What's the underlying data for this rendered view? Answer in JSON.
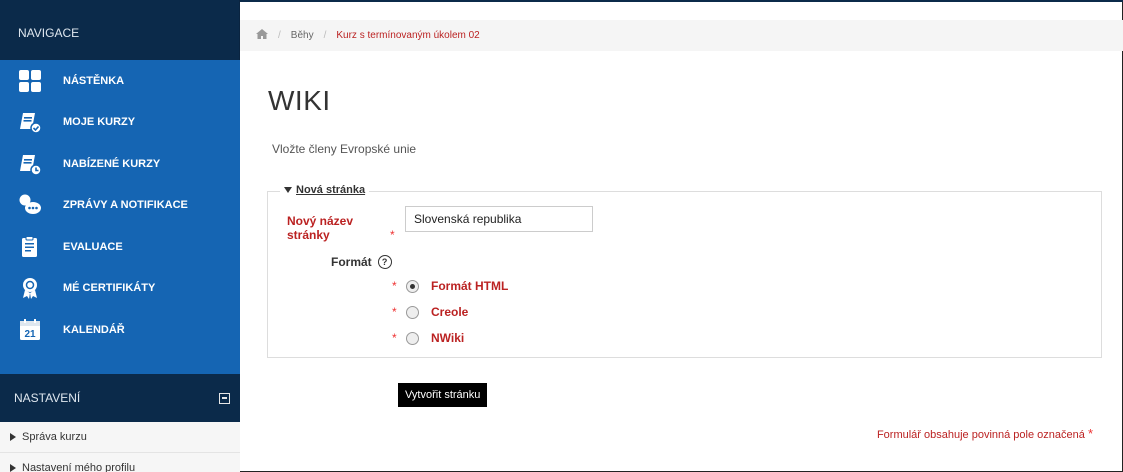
{
  "sidebar": {
    "nav_title": "NAVIGACE",
    "items": [
      {
        "label": "NÁSTĚNKA",
        "icon": "dashboard-icon"
      },
      {
        "label": "MOJE KURZY",
        "icon": "courses-icon"
      },
      {
        "label": "NABÍZENÉ KURZY",
        "icon": "offered-courses-icon"
      },
      {
        "label": "ZPRÁVY A NOTIFIKACE",
        "icon": "messages-icon"
      },
      {
        "label": "EVALUACE",
        "icon": "evaluation-icon"
      },
      {
        "label": "MÉ CERTIFIKÁTY",
        "icon": "certificate-icon"
      },
      {
        "label": "KALENDÁŘ",
        "icon": "calendar-icon"
      }
    ],
    "calendar_day": "21",
    "settings_title": "NASTAVENÍ",
    "settings_items": [
      "Správa kurzu",
      "Nastavení mého profilu"
    ]
  },
  "breadcrumb": {
    "items": [
      "Běhy",
      "Kurz s termínovaným úkolem 02"
    ]
  },
  "main": {
    "title": "WIKI",
    "intro": "Vložte členy Evropské unie",
    "legend": "Nová stránka",
    "name_label": "Nový název stránky",
    "name_value": "Slovenská republika",
    "format_label": "Formát",
    "formats": [
      {
        "label": "Formát HTML",
        "checked": true
      },
      {
        "label": "Creole",
        "checked": false
      },
      {
        "label": "NWiki",
        "checked": false
      }
    ],
    "submit_label": "Vytvořit stránku",
    "required_note": "Formulář obsahuje povinná pole označená"
  },
  "colors": {
    "sidebar_dark": "#0b2a4a",
    "sidebar_blue": "#1565b3",
    "required_red": "#bb2222"
  }
}
